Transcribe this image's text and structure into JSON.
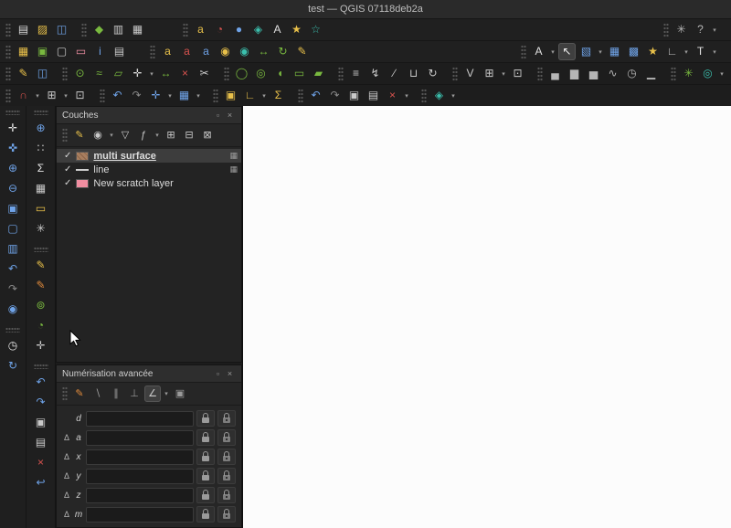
{
  "window": {
    "title": "test — QGIS 07118deb2a"
  },
  "colors": {
    "titlebar": "#2a2a2a",
    "toolbar": "#202020",
    "panel": "#262626",
    "selection_row": "#3d3d3d",
    "canvas": "#fcfcfc",
    "accent_yellow": "#e8c04a",
    "accent_green": "#79b93f",
    "accent_blue": "#6fa3e8",
    "accent_red": "#d9534f",
    "accent_teal": "#3bbfad"
  },
  "toolbars": {
    "row1_left": [
      [
        {
          "name": "new-project-icon",
          "glyph": "▤",
          "color": "#d9d9d9"
        },
        {
          "name": "open-project-icon",
          "glyph": "▨",
          "color": "#e8c04a"
        },
        {
          "name": "save-project-icon",
          "glyph": "◫",
          "color": "#6fa3e8"
        }
      ],
      [
        {
          "name": "style-manager-icon",
          "glyph": "◆",
          "color": "#79b93f"
        },
        {
          "name": "new-print-layout-icon",
          "glyph": "▥",
          "color": "#c9c9c9"
        },
        {
          "name": "layout-manager-icon",
          "glyph": "▦",
          "color": "#c9c9c9"
        }
      ],
      {
        "gap": 28,
        "items": [
          {
            "name": "layer-labeling-icon",
            "glyph": "a",
            "color": "#e8c04a"
          },
          {
            "name": "layer-diagram-icon",
            "glyph": "◔",
            "color": "#d9534f"
          },
          {
            "name": "map-tips-icon",
            "glyph": "●",
            "color": "#6fa3e8"
          },
          {
            "name": "decorations-icon",
            "glyph": "◈",
            "color": "#3bbfad"
          },
          {
            "name": "text-annotation-icon",
            "glyph": "A",
            "color": "#e0e0e0"
          },
          {
            "name": "new-bookmark-icon",
            "glyph": "★",
            "color": "#e8c04a"
          },
          {
            "name": "show-bookmarks-icon",
            "glyph": "☆",
            "color": "#3bbfad"
          }
        ]
      }
    ],
    "row1_right": [
      [
        {
          "name": "processing-toolbox-icon",
          "glyph": "✳",
          "color": "#b5b5b5"
        },
        {
          "name": "help-contents-icon",
          "glyph": "?",
          "color": "#b5b5b5",
          "dd": true
        }
      ]
    ],
    "row2_left": [
      [
        {
          "name": "data-source-manager-icon",
          "glyph": "▦",
          "color": "#e8c04a"
        },
        {
          "name": "new-geopackage-icon",
          "glyph": "▣",
          "color": "#79b93f"
        },
        {
          "name": "new-shapefile-icon",
          "glyph": "▢",
          "color": "#c9c9c9"
        },
        {
          "name": "new-scratch-layer-icon",
          "glyph": "▭",
          "color": "#ef8fa3"
        },
        {
          "name": "identify-features-icon",
          "glyph": "i",
          "color": "#6fa3e8"
        },
        {
          "name": "open-attribute-table-icon",
          "glyph": "▤",
          "color": "#c9c9c9"
        }
      ],
      {
        "gap": 12,
        "items": [
          {
            "name": "layer-labeling-options-icon",
            "glyph": "a",
            "color": "#e8c04a"
          },
          {
            "name": "rule-based-labeling-icon",
            "glyph": "a",
            "color": "#d9534f"
          },
          {
            "name": "diagram-options-icon",
            "glyph": "a",
            "color": "#6fa3e8"
          },
          {
            "name": "pin-labels-icon",
            "glyph": "◉",
            "color": "#e8c04a"
          },
          {
            "name": "highlight-labels-icon",
            "glyph": "◉",
            "color": "#3bbfad"
          },
          {
            "name": "move-label-icon",
            "glyph": "↔",
            "color": "#79b93f"
          },
          {
            "name": "rotate-label-icon",
            "glyph": "↻",
            "color": "#79b93f"
          },
          {
            "name": "change-label-icon",
            "glyph": "✎",
            "color": "#e8c04a"
          }
        ]
      }
    ],
    "row2_right": [
      [
        {
          "name": "text-format-icon",
          "glyph": "A",
          "color": "#e0e0e0",
          "dd": true
        },
        {
          "name": "pointer-tool-icon",
          "glyph": "↖",
          "color": "#f2f2f2",
          "pressed": true
        },
        {
          "name": "select-rectangle-icon",
          "glyph": "▧",
          "color": "#6fa3e8",
          "dd": true
        },
        {
          "name": "select-by-value-icon",
          "glyph": "▦",
          "color": "#6fa3e8"
        },
        {
          "name": "deselect-all-icon",
          "glyph": "▩",
          "color": "#6fa3e8"
        },
        {
          "name": "favorites-icon",
          "glyph": "★",
          "color": "#e8c04a"
        },
        {
          "name": "measure-icon",
          "glyph": "∟",
          "color": "#c9c9c9",
          "dd": true
        },
        {
          "name": "map-annotation-icon",
          "glyph": "T",
          "color": "#e0e0e0",
          "dd": true
        }
      ]
    ],
    "row3_left": [
      [
        {
          "name": "toggle-editing-icon",
          "glyph": "✎",
          "color": "#e8c04a"
        },
        {
          "name": "save-edits-icon",
          "glyph": "◫",
          "color": "#6fa3e8"
        }
      ],
      [
        {
          "name": "add-point-feature-icon",
          "glyph": "⊙",
          "color": "#79b93f"
        },
        {
          "name": "add-line-feature-icon",
          "glyph": "≈",
          "color": "#79b93f"
        },
        {
          "name": "add-polygon-feature-icon",
          "glyph": "▱",
          "color": "#79b93f"
        },
        {
          "name": "vertex-tool-icon",
          "glyph": "✛",
          "color": "#d9d9d9",
          "dd": true
        },
        {
          "name": "move-feature-icon",
          "glyph": "↔",
          "color": "#79b93f"
        },
        {
          "name": "delete-selected-icon",
          "glyph": "×",
          "color": "#d9534f"
        },
        {
          "name": "cut-features-icon",
          "glyph": "✂",
          "color": "#c9c9c9"
        }
      ],
      [
        {
          "name": "circle-2points-icon",
          "glyph": "◯",
          "color": "#79b93f"
        },
        {
          "name": "circle-3points-icon",
          "glyph": "◎",
          "color": "#79b93f"
        },
        {
          "name": "ellipse-icon",
          "glyph": "◖",
          "color": "#79b93f"
        },
        {
          "name": "rectangle-icon",
          "glyph": "▭",
          "color": "#79b93f"
        },
        {
          "name": "regular-polygon-icon",
          "glyph": "▰",
          "color": "#79b93f"
        }
      ],
      [
        {
          "name": "offset-curve-icon",
          "glyph": "≡",
          "color": "#c9c9c9"
        },
        {
          "name": "reshape-features-icon",
          "glyph": "↯",
          "color": "#c9c9c9"
        },
        {
          "name": "split-features-icon",
          "glyph": "∕",
          "color": "#c9c9c9"
        },
        {
          "name": "merge-features-icon",
          "glyph": "⊔",
          "color": "#c9c9c9"
        },
        {
          "name": "rotate-feature-icon",
          "glyph": "↻",
          "color": "#c9c9c9"
        }
      ],
      [
        {
          "name": "vertex-editor-icon",
          "glyph": "V",
          "color": "#c9c9c9"
        },
        {
          "name": "grid-options-icon",
          "glyph": "⊞",
          "color": "#c9c9c9",
          "dd": true
        },
        {
          "name": "snap-options-icon",
          "glyph": "⊡",
          "color": "#c9c9c9"
        }
      ]
    ],
    "row3_right": [
      [
        {
          "name": "statistical-summary-icon",
          "glyph": "▄",
          "color": "#b5b5b5"
        },
        {
          "name": "histogram-icon",
          "glyph": "▆",
          "color": "#b5b5b5"
        },
        {
          "name": "raster-histogram-icon",
          "glyph": "▅",
          "color": "#b5b5b5"
        },
        {
          "name": "profile-tool-icon",
          "glyph": "∿",
          "color": "#b5b5b5"
        },
        {
          "name": "temporal-control-icon",
          "glyph": "◷",
          "color": "#b5b5b5"
        },
        {
          "name": "elevation-profile-icon",
          "glyph": "▁",
          "color": "#b5b5b5"
        }
      ],
      [
        {
          "name": "plugin-icon",
          "glyph": "✳",
          "color": "#79b93f"
        },
        {
          "name": "osm-search-icon",
          "glyph": "◎",
          "color": "#3bbfad",
          "dd": true
        }
      ]
    ],
    "row4_left": [
      [
        {
          "name": "snapping-toggle-icon",
          "glyph": "∩",
          "color": "#d9534f",
          "dd": true
        },
        {
          "name": "snapping-type-icon",
          "glyph": "⊞",
          "color": "#c9c9c9",
          "dd": true
        },
        {
          "name": "topological-editing-icon",
          "glyph": "⊡",
          "color": "#c9c9c9"
        }
      ],
      [
        {
          "name": "zoom-last-icon",
          "glyph": "↶",
          "color": "#6fa3e8"
        },
        {
          "name": "zoom-next-icon",
          "glyph": "↷",
          "color": "#8a8a8a"
        },
        {
          "name": "pan-to-selection-icon",
          "glyph": "✛",
          "color": "#6fa3e8",
          "dd": true
        },
        {
          "name": "new-map-view-icon",
          "glyph": "▦",
          "color": "#6fa3e8",
          "dd": true
        }
      ],
      [
        {
          "name": "highlight-features-icon",
          "glyph": "▣",
          "color": "#e8c04a"
        },
        {
          "name": "measure-area-icon",
          "glyph": "∟",
          "color": "#e8c04a",
          "dd": true
        },
        {
          "name": "field-calculator-icon",
          "glyph": "Σ",
          "color": "#e8c04a"
        }
      ],
      [
        {
          "name": "undo-icon",
          "glyph": "↶",
          "color": "#6fa3e8"
        },
        {
          "name": "redo-icon",
          "glyph": "↷",
          "color": "#8a8a8a"
        },
        {
          "name": "copy-style-icon",
          "glyph": "▣",
          "color": "#c9c9c9"
        },
        {
          "name": "paste-style-icon",
          "glyph": "▤",
          "color": "#c9c9c9"
        },
        {
          "name": "delete-part-icon",
          "glyph": "×",
          "color": "#d9534f",
          "dd": true
        }
      ],
      [
        {
          "name": "georeferencer-icon",
          "glyph": "◈",
          "color": "#3bbfad",
          "dd": true
        }
      ]
    ],
    "col1": [
      [
        {
          "name": "pan-map-icon",
          "glyph": "✛",
          "color": "#e8e8e8"
        },
        {
          "name": "pan-to-selection-icon",
          "glyph": "✜",
          "color": "#6fa3e8"
        },
        {
          "name": "zoom-in-icon",
          "glyph": "⊕",
          "color": "#6fa3e8"
        },
        {
          "name": "zoom-out-icon",
          "glyph": "⊖",
          "color": "#6fa3e8"
        },
        {
          "name": "zoom-full-icon",
          "glyph": "▣",
          "color": "#6fa3e8"
        },
        {
          "name": "zoom-to-selection-icon",
          "glyph": "▢",
          "color": "#6fa3e8"
        },
        {
          "name": "zoom-to-layer-icon",
          "glyph": "▥",
          "color": "#6fa3e8"
        },
        {
          "name": "zoom-last-icon",
          "glyph": "↶",
          "color": "#6fa3e8"
        },
        {
          "name": "zoom-next-icon",
          "glyph": "↷",
          "color": "#8a8a8a"
        },
        {
          "name": "zoom-native-icon",
          "glyph": "◉",
          "color": "#6fa3e8"
        }
      ],
      [
        {
          "name": "temporal-controller-icon",
          "glyph": "◷",
          "color": "#e8e8e8"
        },
        {
          "name": "refresh-map-icon",
          "glyph": "↻",
          "color": "#6fa3e8"
        }
      ]
    ],
    "col2": [
      [
        {
          "name": "identify-features-icon",
          "glyph": "⊕",
          "color": "#6fa3e8"
        },
        {
          "name": "select-matrix-icon",
          "glyph": "∷",
          "color": "#c9c9c9"
        },
        {
          "name": "statistical-summary-icon",
          "glyph": "Σ",
          "color": "#e8e8e8"
        },
        {
          "name": "attribute-table-icon",
          "glyph": "▦",
          "color": "#c9c9c9"
        },
        {
          "name": "map-tips-icon",
          "glyph": "▭",
          "color": "#e8c04a"
        },
        {
          "name": "processing-options-icon",
          "glyph": "✳",
          "color": "#c9c9c9"
        }
      ],
      [
        {
          "name": "edit-pencil-icon",
          "glyph": "✎",
          "color": "#e8c04a"
        },
        {
          "name": "draw-annotation-icon",
          "glyph": "✎",
          "color": "#e08a3c"
        },
        {
          "name": "add-ring-icon",
          "glyph": "⊚",
          "color": "#79b93f"
        },
        {
          "name": "add-part-icon",
          "glyph": "◔",
          "color": "#79b93f"
        },
        {
          "name": "node-tool-icon",
          "glyph": "✛",
          "color": "#c9c9c9"
        }
      ],
      [
        {
          "name": "undo-icon",
          "glyph": "↶",
          "color": "#6fa3e8"
        },
        {
          "name": "redo-icon",
          "glyph": "↷",
          "color": "#6fa3e8"
        },
        {
          "name": "copy-features-icon",
          "glyph": "▣",
          "color": "#c9c9c9"
        },
        {
          "name": "paste-features-icon",
          "glyph": "▤",
          "color": "#c9c9c9"
        },
        {
          "name": "delete-feature-icon",
          "glyph": "×",
          "color": "#d9534f"
        },
        {
          "name": "revert-edits-icon",
          "glyph": "↩",
          "color": "#6fa3e8"
        }
      ]
    ]
  },
  "layers_panel": {
    "title": "Couches",
    "float_glyph": "▫",
    "close_glyph": "×",
    "tools": [
      [
        {
          "name": "layer-styling-icon",
          "glyph": "✎",
          "color": "#e8c04a"
        },
        {
          "name": "map-themes-icon",
          "glyph": "◉",
          "color": "#c9c9c9",
          "dd": true
        },
        {
          "name": "filter-legend-icon",
          "glyph": "▽",
          "color": "#c9c9c9"
        },
        {
          "name": "filter-expression-icon",
          "glyph": "ƒ",
          "color": "#c9c9c9",
          "dd": true
        },
        {
          "name": "expand-all-icon",
          "glyph": "⊞",
          "color": "#c9c9c9"
        },
        {
          "name": "collapse-all-icon",
          "glyph": "⊟",
          "color": "#c9c9c9"
        },
        {
          "name": "remove-layer-icon",
          "glyph": "⊠",
          "color": "#c9c9c9"
        }
      ]
    ],
    "check_glyph": "✓",
    "indicator_glyph": "▦",
    "items": [
      {
        "label": "multi surface",
        "checked": true,
        "selected": true,
        "symbol": "polygon",
        "symbol_color": "#a87e5f",
        "indicator": true
      },
      {
        "label": "line",
        "checked": true,
        "selected": false,
        "symbol": "line",
        "symbol_color": "#d0d0d0",
        "indicator": true
      },
      {
        "label": "New scratch layer",
        "checked": true,
        "selected": false,
        "symbol": "fill",
        "symbol_color": "#f08da0",
        "indicator": false
      }
    ]
  },
  "adv_panel": {
    "title": "Numérisation avancée",
    "float_glyph": "▫",
    "close_glyph": "×",
    "delta_glyph": "Δ",
    "tools": [
      [
        {
          "name": "enable-advanced-digitizing-icon",
          "glyph": "✎",
          "color": "#e08a3c"
        },
        {
          "name": "construction-mode-icon",
          "glyph": "∖",
          "color": "#9a9a9a"
        },
        {
          "name": "parallel-icon",
          "glyph": "∥",
          "color": "#9a9a9a"
        },
        {
          "name": "perpendicular-icon",
          "glyph": "⊥",
          "color": "#9a9a9a"
        },
        {
          "name": "snap-common-angles-icon",
          "glyph": "∠",
          "color": "#c9c9c9",
          "pressed": true,
          "dd": true
        },
        {
          "name": "floater-icon",
          "glyph": "▣",
          "color": "#9a9a9a"
        }
      ]
    ],
    "rows": [
      {
        "label": "d",
        "delta": false,
        "value": ""
      },
      {
        "label": "a",
        "delta": true,
        "value": ""
      },
      {
        "label": "x",
        "delta": true,
        "value": ""
      },
      {
        "label": "y",
        "delta": true,
        "value": ""
      },
      {
        "label": "z",
        "delta": true,
        "value": ""
      },
      {
        "label": "m",
        "delta": true,
        "value": ""
      }
    ]
  }
}
